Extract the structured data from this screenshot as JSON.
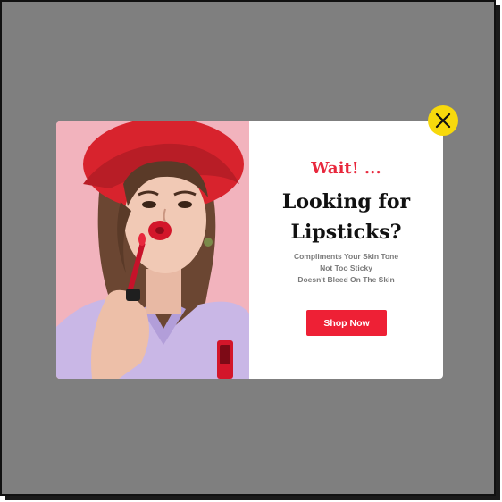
{
  "popup": {
    "eyebrow": "Wait! ...",
    "headline_line1": "Looking for",
    "headline_line2": "Lipsticks?",
    "features": [
      "Compliments Your Skin Tone",
      "Not Too Sticky",
      "Doesn't Bleed On The Skin"
    ],
    "cta_label": "Shop Now",
    "close_icon": "close-icon",
    "image_subject": "woman-applying-lipstick"
  },
  "colors": {
    "overlay": "#7f7f7f",
    "accent": "#e8283d",
    "button": "#ee2035",
    "close_button": "#f7d90c",
    "photo_background": "#f2b3bd",
    "hat": "#d8232d"
  }
}
